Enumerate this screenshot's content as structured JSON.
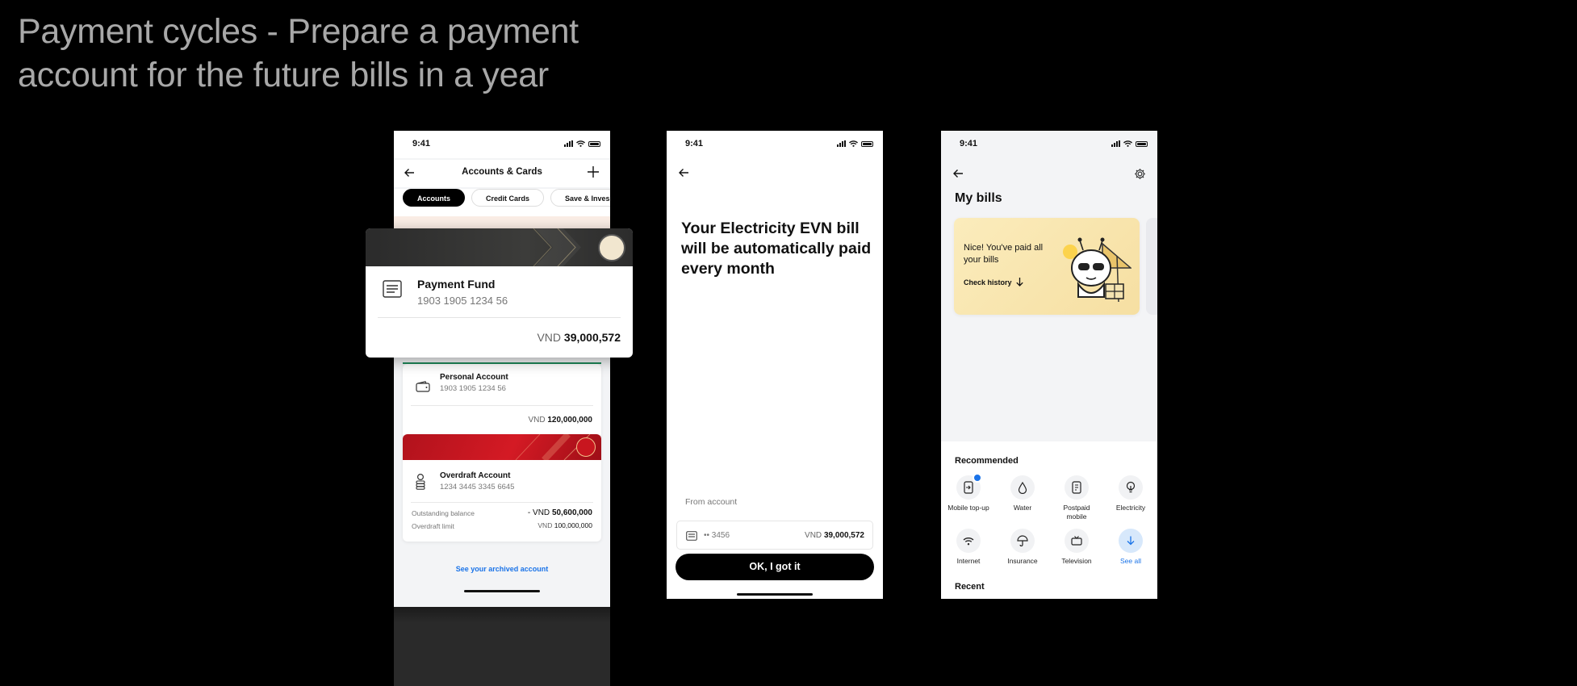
{
  "slide": {
    "title": "Payment cycles - Prepare a payment account for the future bills in a year"
  },
  "phone1": {
    "time": "9:41",
    "title": "Accounts & Cards",
    "tabs": [
      "Accounts",
      "Credit Cards",
      "Save & Inves"
    ],
    "personal": {
      "name": "Personal Account",
      "number": "1903 1905 1234 56",
      "currency": "VND",
      "amount": "120,000,000"
    },
    "overdraft": {
      "name": "Overdraft Account",
      "number": "1234 3445 3345 6645",
      "outstanding_label": "Outstanding balance",
      "outstanding_prefix": "- VND",
      "outstanding_value": "50,600,000",
      "limit_label": "Overdraft limit",
      "limit_currency": "VND",
      "limit_value": "100,000,000"
    },
    "archived_link": "See your archived account"
  },
  "popup": {
    "name": "Payment Fund",
    "number": "1903 1905 1234 56",
    "currency": "VND",
    "amount": "39,000,572"
  },
  "phone2": {
    "time": "9:41",
    "headline": "Your Electricity EVN bill will be automatically paid every month",
    "from_label": "From account",
    "account_mask": "•• 3456",
    "currency": "VND",
    "amount": "39,000,572",
    "ok_button": "OK, I got it"
  },
  "phone3": {
    "time": "9:41",
    "title": "My bills",
    "banner_text": "Nice! You've paid all your bills",
    "check_history": "Check history",
    "recommended_label": "Recommended",
    "services": [
      {
        "label": "Mobile top-up",
        "icon": "mobile-topup-icon"
      },
      {
        "label": "Water",
        "icon": "water-drop-icon"
      },
      {
        "label": "Postpaid mobile",
        "icon": "postpaid-mobile-icon"
      },
      {
        "label": "Electricity",
        "icon": "lightbulb-icon"
      },
      {
        "label": "Internet",
        "icon": "wifi-icon"
      },
      {
        "label": "Insurance",
        "icon": "umbrella-icon"
      },
      {
        "label": "Television",
        "icon": "tv-icon"
      },
      {
        "label": "See all",
        "icon": "arrow-down-icon"
      }
    ],
    "recent_label": "Recent"
  },
  "colors": {
    "accent_blue": "#1a73e8",
    "banner_red": "#c8161f",
    "banner_yellow": "#f6dfa2",
    "background": "#000000"
  }
}
